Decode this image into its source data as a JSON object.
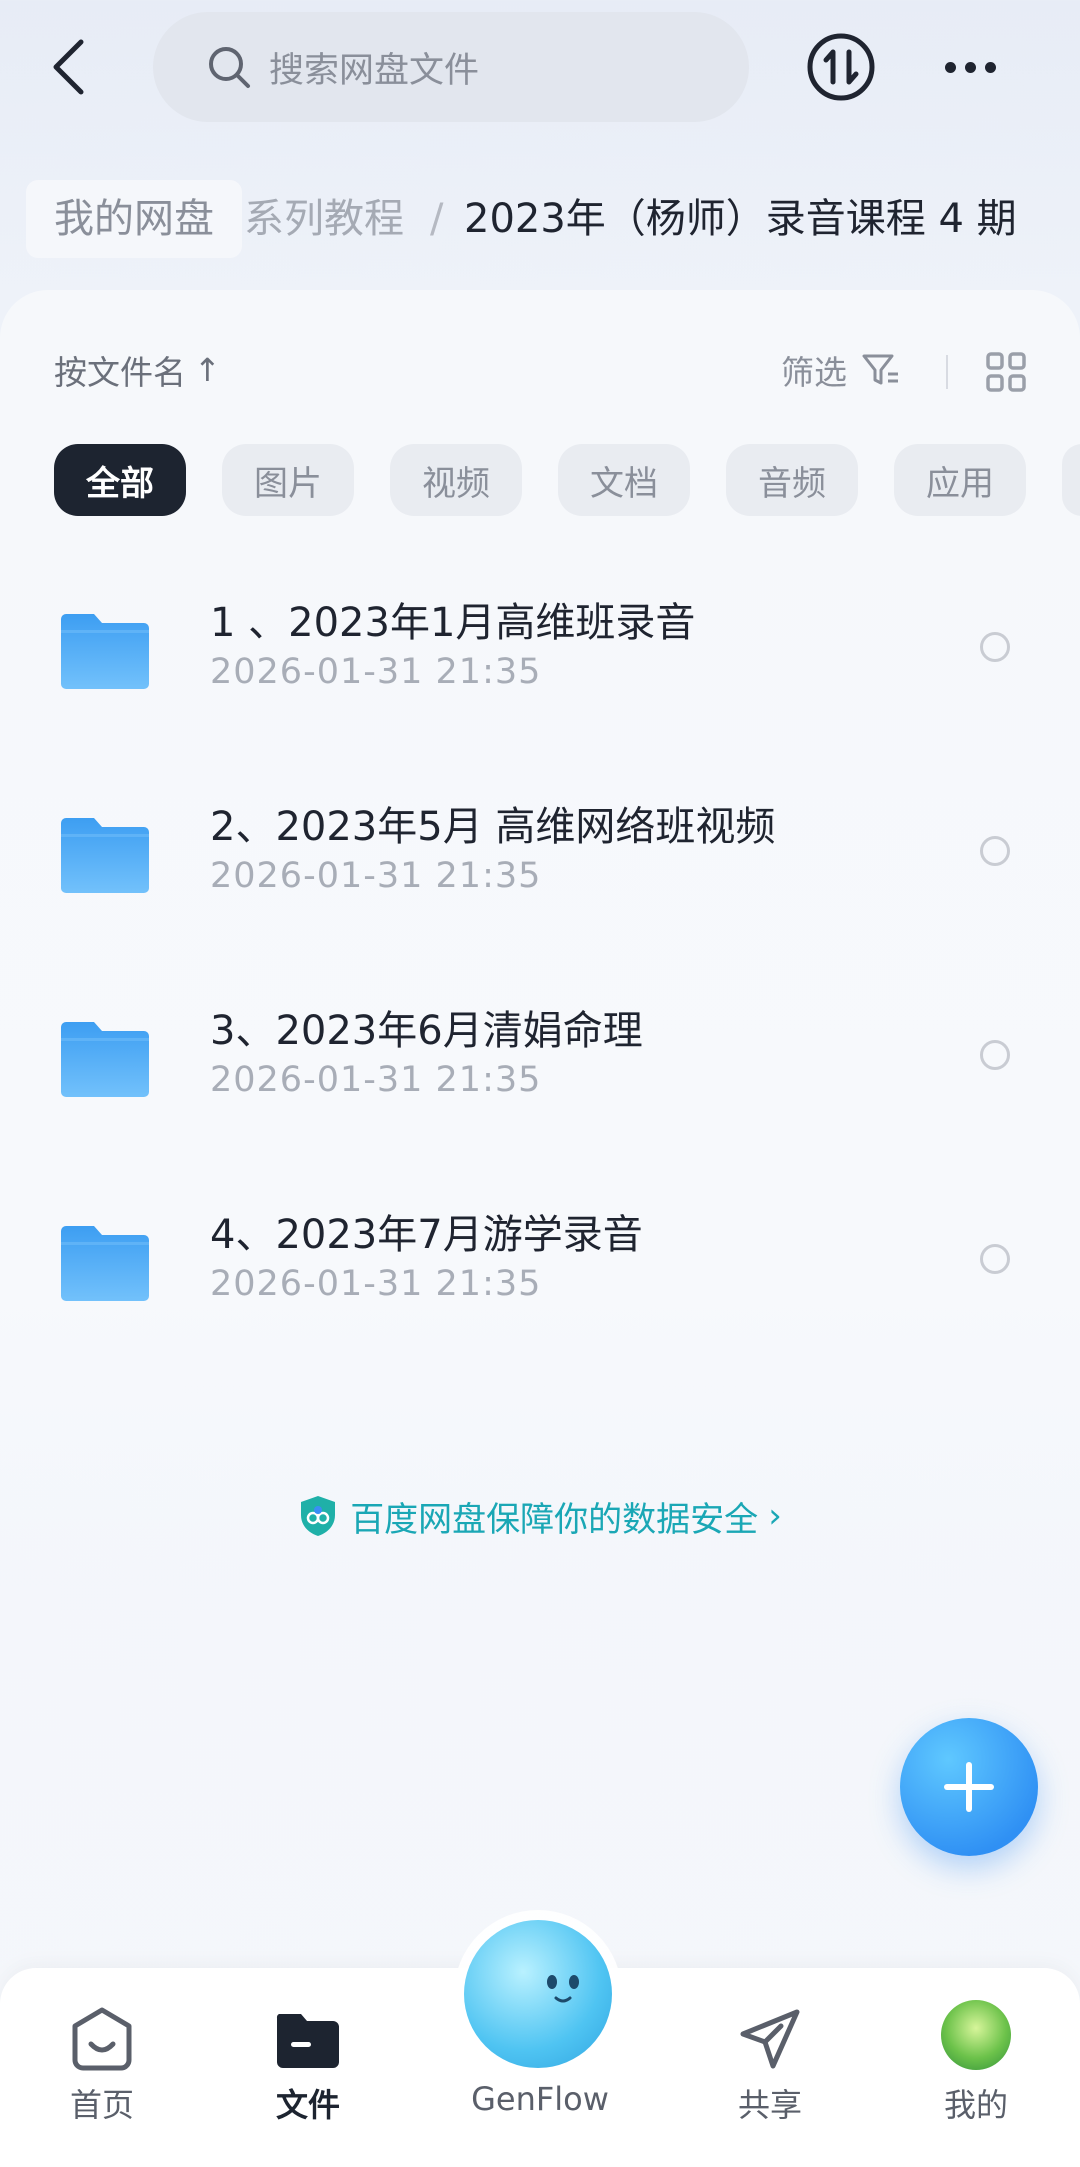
{
  "search": {
    "placeholder": "搜索网盘文件"
  },
  "breadcrumb": {
    "home": "我的网盘",
    "middle": "系列教程",
    "separator": "/",
    "current": "2023年（杨师）录音课程 4 期"
  },
  "sort": {
    "label": "按文件名",
    "arrow": "↑"
  },
  "filter": {
    "label": "筛选"
  },
  "chips": [
    "全部",
    "图片",
    "视频",
    "文档",
    "音频",
    "应用"
  ],
  "files": [
    {
      "name": "1 、2023年1月高维班录音",
      "date": "2026-01-31  21:35"
    },
    {
      "name": "2、2023年5月 高维网络班视频",
      "date": "2026-01-31  21:35"
    },
    {
      "name": "3、2023年6月清娟命理",
      "date": "2026-01-31  21:35"
    },
    {
      "name": "4、2023年7月游学录音",
      "date": "2026-01-31  21:35"
    }
  ],
  "security": {
    "text": "百度网盘保障你的数据安全",
    "chevron": "›"
  },
  "nav": {
    "home": "首页",
    "files": "文件",
    "genflow": "GenFlow",
    "share": "共享",
    "me": "我的"
  },
  "colors": {
    "accent": "#2f90f4",
    "security": "#1aa7b5",
    "activeChip": "#1d2430",
    "folder": "#4aa9f5"
  }
}
